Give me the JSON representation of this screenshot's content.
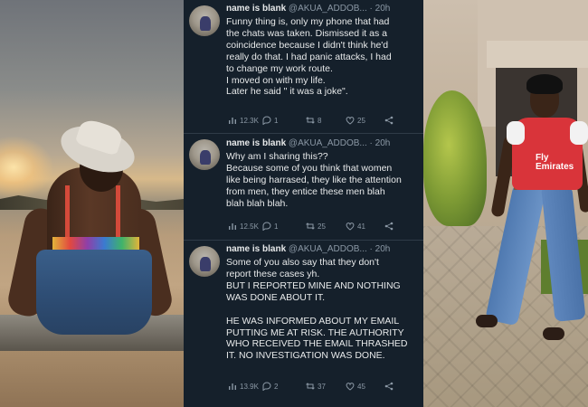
{
  "colors": {
    "feed_bg": "#15202b",
    "primary_text": "#e7e9ea",
    "secondary_text": "#8b98a5"
  },
  "tweets": [
    {
      "display_name": "name is blank",
      "handle": "@AKUA_ADDOB...",
      "time": "· 20h",
      "lines": [
        "Funny thing is, only my phone that had",
        "the chats was taken. Dismissed it as a",
        "coincidence because I didn't think he'd",
        "really do that. I had panic attacks, I had",
        "to change my work route.",
        "I moved on with my life.",
        "Later he said \" it was a joke\"."
      ],
      "views": "12.3K",
      "replies": "1",
      "retweets": "8",
      "likes": "25"
    },
    {
      "display_name": "name is blank",
      "handle": "@AKUA_ADDOB...",
      "time": "· 20h",
      "lines": [
        "Why am I sharing this??",
        "Because some of you think that women",
        "like being harrased, they like the attention",
        "from men, they entice these men blah",
        "blah blah blah."
      ],
      "views": "12.5K",
      "replies": "1",
      "retweets": "25",
      "likes": "41"
    },
    {
      "display_name": "name is blank",
      "handle": "@AKUA_ADDOB...",
      "time": "· 20h",
      "paragraphs": [
        [
          "Some of you also say that they don't",
          "report these cases yh.",
          "BUT I REPORTED MINE AND NOTHING",
          "WAS DONE ABOUT IT."
        ],
        [
          "HE WAS INFORMED ABOUT MY EMAIL",
          "PUTTING ME AT RISK. THE AUTHORITY",
          "WHO RECEIVED THE EMAIL THRASHED",
          "IT. NO INVESTIGATION WAS DONE."
        ]
      ],
      "views": "13.9K",
      "replies": "2",
      "retweets": "37",
      "likes": "45"
    }
  ],
  "photo_right": {
    "jersey_text": "Fly Emirates"
  },
  "icons": {
    "views": "bar-chart-icon",
    "reply": "reply-icon",
    "retweet": "retweet-icon",
    "like": "heart-icon",
    "share": "share-icon"
  }
}
